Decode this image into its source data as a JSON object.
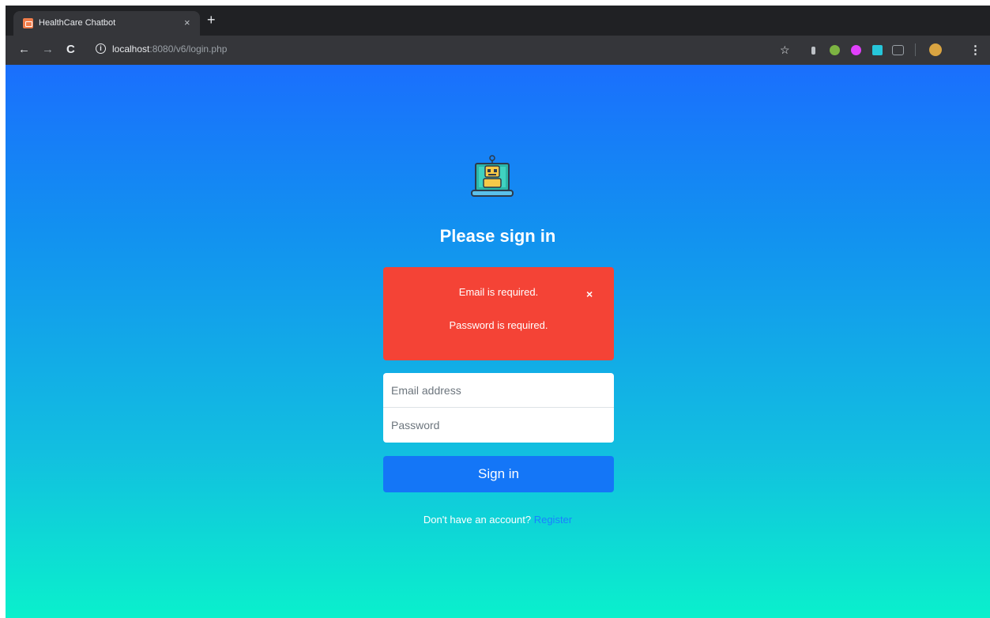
{
  "browser": {
    "tab_title": "HealthCare Chatbot",
    "tab_close": "×",
    "new_tab": "+",
    "url_host": "localhost",
    "url_rest": ":8080/v6/login.php"
  },
  "page": {
    "title": "Please sign in",
    "alert": {
      "messages": [
        "Email is required.",
        "Password is required."
      ],
      "close": "×",
      "color": "#f44336"
    },
    "email_placeholder": "Email address",
    "password_placeholder": "Password",
    "signin_label": "Sign in",
    "register_prompt": "Don't have an account?",
    "register_link": "Register",
    "accent": "#1476f7"
  }
}
